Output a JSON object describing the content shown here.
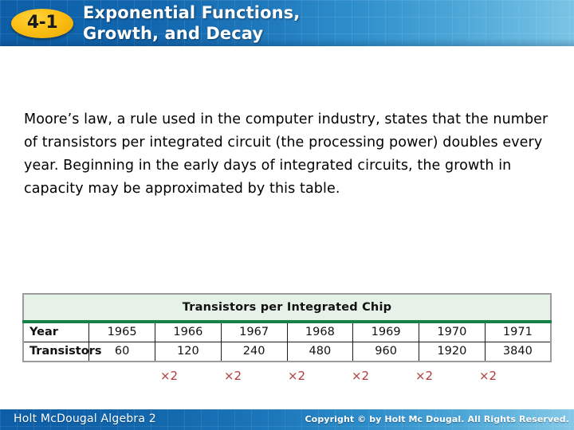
{
  "header": {
    "badge_label": "4-1",
    "title": "Exponential Functions,\nGrowth, and Decay",
    "accent_color": "#0d5ea6",
    "badge_color": "#fcbf16"
  },
  "body": {
    "paragraph": "Moore’s law, a rule used in the computer industry, states that the number of transistors per integrated circuit (the processing power) doubles every year. Beginning in the early days of integrated circuits, the growth in capacity may be approximated by this table."
  },
  "table": {
    "caption": "Transistors per Integrated Chip",
    "caption_bg": "#e6f2e8",
    "caption_rule_color": "#17804a",
    "row_labels": [
      "Year",
      "Transistors"
    ],
    "rows": [
      [
        "Year",
        "1965",
        "1966",
        "1967",
        "1968",
        "1969",
        "1970",
        "1971"
      ],
      [
        "Transistors",
        "60",
        "120",
        "240",
        "480",
        "960",
        "1920",
        "3840"
      ]
    ]
  },
  "annotations": {
    "color": "#b03a3a",
    "multipliers": [
      "×2",
      "×2",
      "×2",
      "×2",
      "×2",
      "×2"
    ]
  },
  "footer": {
    "left": "Holt McDougal Algebra 2",
    "right": "Copyright © by Holt Mc Dougal. All Rights Reserved."
  },
  "chart_data": {
    "type": "table",
    "title": "Transistors per Integrated Chip",
    "categories": [
      "1965",
      "1966",
      "1967",
      "1968",
      "1969",
      "1970",
      "1971"
    ],
    "values": [
      60,
      120,
      240,
      480,
      960,
      1920,
      3840
    ],
    "xlabel": "Year",
    "ylabel": "Transistors",
    "annotations": [
      "×2",
      "×2",
      "×2",
      "×2",
      "×2",
      "×2"
    ]
  }
}
